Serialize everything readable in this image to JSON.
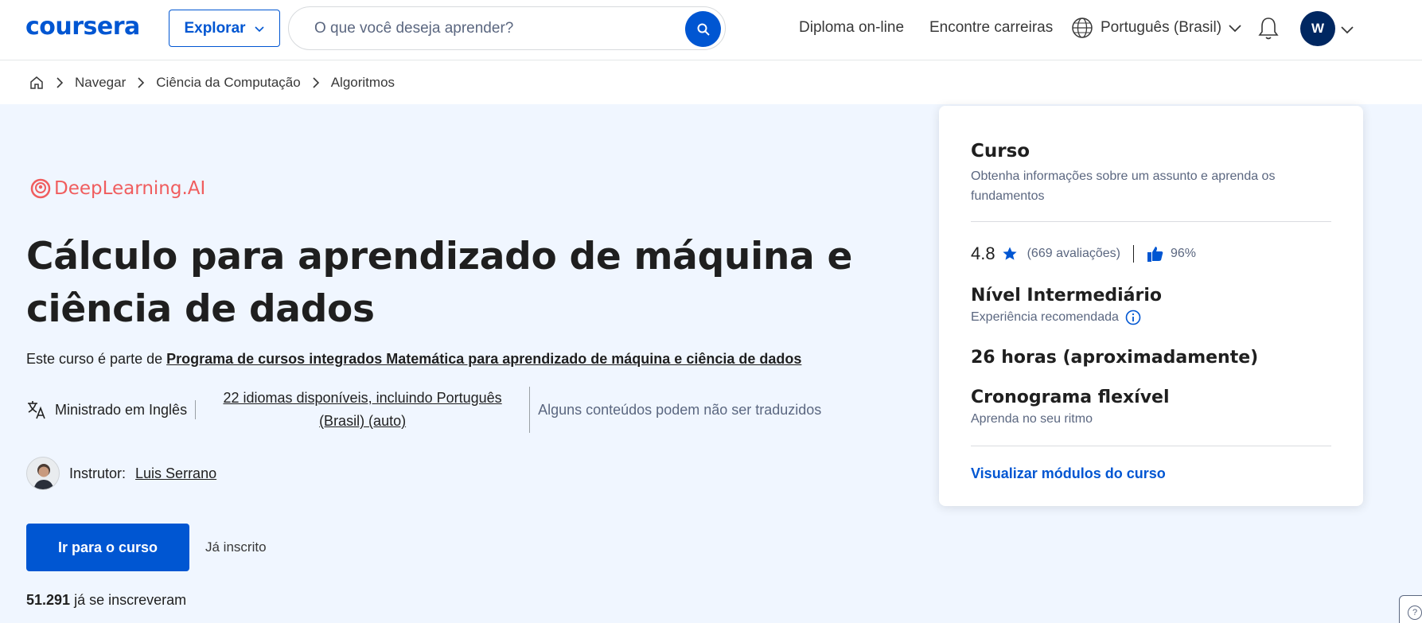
{
  "header": {
    "logo": "coursera",
    "explore_label": "Explorar",
    "search_placeholder": "O que você deseja aprender?",
    "nav": {
      "degrees": "Diploma on-line",
      "careers": "Encontre carreiras"
    },
    "language": "Português (Brasil)",
    "avatar_initial": "W"
  },
  "breadcrumb": [
    "Navegar",
    "Ciência da Computação",
    "Algoritmos"
  ],
  "course": {
    "partner": "DeepLearning.AI",
    "title": "Cálculo para aprendizado de máquina e ciência de dados",
    "part_of_prefix": "Este curso é parte de",
    "part_of_link": "Programa de cursos integrados Matemática para aprendizado de máquina e ciência de dados",
    "taught_in": "Ministrado em Inglês",
    "languages_available": "22 idiomas disponíveis, incluindo Português (Brasil) (auto)",
    "translation_note": "Alguns conteúdos podem não ser traduzidos",
    "instructor_label": "Instrutor:",
    "instructor_name": "Luis Serrano",
    "cta_label": "Ir para o curso",
    "enrolled_label": "Já inscrito",
    "enrolled_count": "51.291",
    "enrolled_suffix": "já se inscreveram"
  },
  "card": {
    "type": "Curso",
    "type_desc": "Obtenha informações sobre um assunto e aprenda os fundamentos",
    "rating": "4.8",
    "reviews": "(669 avaliações)",
    "like_pct": "96%",
    "level": "Nível Intermediário",
    "level_sub": "Experiência recomendada",
    "duration": "26 horas (aproximadamente)",
    "schedule": "Cronograma flexível",
    "schedule_sub": "Aprenda no seu ritmo",
    "modules_link": "Visualizar módulos do curso"
  },
  "colors": {
    "brand": "#0056d2",
    "hero_bg": "#f0f6ff",
    "partner": "#f05d5e"
  },
  "icons": [
    "chevron-down-icon",
    "search-icon",
    "globe-icon",
    "bell-icon",
    "home-icon",
    "chevron-right-icon",
    "translate-icon",
    "star-icon",
    "thumbs-up-icon",
    "info-icon",
    "help-icon"
  ]
}
